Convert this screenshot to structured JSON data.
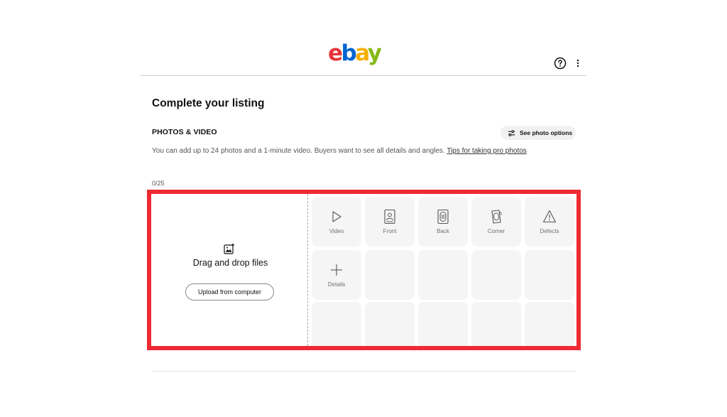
{
  "header": {
    "logo": {
      "letters": [
        "e",
        "b",
        "a",
        "y"
      ],
      "colors": [
        "#e53238",
        "#0064d2",
        "#f5af02",
        "#86b817"
      ]
    },
    "help_icon": "help-circle-icon",
    "more_icon": "more-vertical-icon"
  },
  "page": {
    "title": "Complete your listing"
  },
  "photos_section": {
    "title": "PHOTOS & VIDEO",
    "options_button": "See photo options",
    "description": "You can add up to 24 photos and a 1-minute video. Buyers want to see all details and angles.",
    "tips_link": "Tips for taking pro photos",
    "count": "0/25",
    "highlight_color": "#ee2a33",
    "dropzone": {
      "title": "Drag and drop files",
      "upload_button": "Upload from computer",
      "icon": "add-photo-icon"
    },
    "slots": [
      {
        "label": "Video",
        "icon": "play-icon"
      },
      {
        "label": "Front",
        "icon": "front-icon"
      },
      {
        "label": "Back",
        "icon": "back-icon"
      },
      {
        "label": "Corner",
        "icon": "corner-icon"
      },
      {
        "label": "Defects",
        "icon": "warning-icon"
      },
      {
        "label": "Details",
        "icon": "plus-icon"
      }
    ]
  }
}
